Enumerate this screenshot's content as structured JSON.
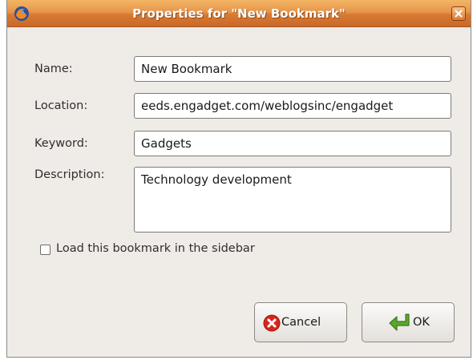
{
  "window": {
    "title": "Properties for \"New Bookmark\""
  },
  "form": {
    "name_label": "Name:",
    "name_value": "New Bookmark",
    "location_label": "Location:",
    "location_value": "eeds.engadget.com/weblogsinc/engadget",
    "keyword_label": "Keyword:",
    "keyword_value": "Gadgets",
    "description_label": "Description:",
    "description_value": "Technology development",
    "sidebar_checkbox_label": "Load this bookmark in the sidebar",
    "sidebar_checkbox_checked": false
  },
  "buttons": {
    "cancel_label": "Cancel",
    "ok_label": "OK"
  },
  "icons": {
    "app": "firefox-icon",
    "close": "close-icon",
    "cancel": "cancel-icon",
    "ok": "ok-arrow-icon"
  },
  "colors": {
    "titlebar": "#e7954b",
    "window_bg": "#efebe7",
    "cancel_icon": "#d8261c",
    "ok_icon": "#5aa82b"
  }
}
